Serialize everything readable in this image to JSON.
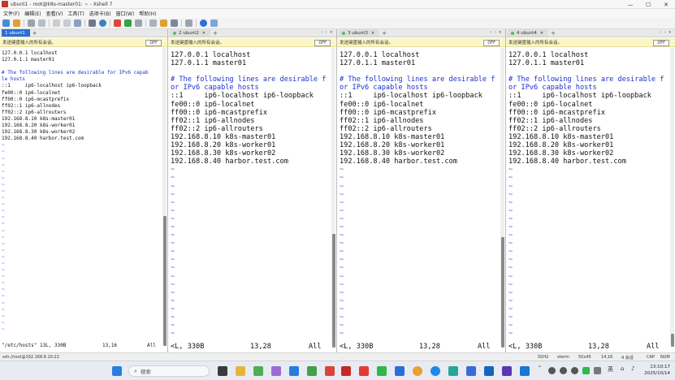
{
  "window": {
    "title": "ubunt1 - root@k8s-master01: ~ - Xshell 7",
    "controls": [
      "—",
      "☐",
      "✕"
    ]
  },
  "menu": [
    "文件(F)",
    "编辑(E)",
    "查看(V)",
    "工具(T)",
    "选项卡(B)",
    "窗口(W)",
    "帮助(H)"
  ],
  "send_bar": {
    "text": "发送键盘输入的所有会话。",
    "button": "OFF"
  },
  "panes": [
    {
      "tab_label": "1 ubunt1",
      "lines": [
        "127.0.0.1 localhost",
        "127.0.1.1 master01",
        "",
        "# The following lines are desirable for IPv6 capab",
        "le hosts",
        "::1     ip6-localhost ip6-loopback",
        "fe00::0 ip6-localnet",
        "ff00::0 ip6-mcastprefix",
        "ff02::1 ip6-allnodes",
        "ff02::2 ip6-allrouters",
        "192.168.8.10 k8s-master01",
        "192.168.8.20 k8s-worker01",
        "192.168.8.30 k8s-worker02",
        "192.168.8.40 harbor.test.com"
      ],
      "tilde_count": 29,
      "status_left": "\"/etc/hosts\" 13L, 330B",
      "status_pos": "13,16",
      "status_right": "All"
    },
    {
      "tab_label": "2 ubunt2",
      "lines": [
        "127.0.0.1 localhost",
        "127.0.1.1 master01",
        "",
        "# The following lines are desirable f",
        "or IPv6 capable hosts",
        "::1     ip6-localhost ip6-loopback",
        "fe00::0 ip6-localnet",
        "ff00::0 ip6-mcastprefix",
        "ff02::1 ip6-allnodes",
        "ff02::2 ip6-allrouters",
        "192.168.8.10 k8s-master01",
        "192.168.8.20 k8s-worker01",
        "192.168.8.30 k8s-worker02",
        "192.168.8.40 harbor.test.com"
      ],
      "tilde_count": 21,
      "status_left": "<L, 330B",
      "status_pos": "13,28",
      "status_right": "All"
    },
    {
      "tab_label": "3 ubunt3",
      "lines": [
        "127.0.0.1 localhost",
        "127.0.1.1 master01",
        "",
        "# The following lines are desirable f",
        "or IPv6 capable hosts",
        "::1     ip6-localhost ip6-loopback",
        "fe00::0 ip6-localnet",
        "ff00::0 ip6-mcastprefix",
        "ff02::1 ip6-allnodes",
        "ff02::2 ip6-allrouters",
        "192.168.8.10 k8s-master01",
        "192.168.8.20 k8s-worker01",
        "192.168.8.30 k8s-worker02",
        "192.168.8.40 harbor.test.com"
      ],
      "tilde_count": 21,
      "status_left": "<L, 330B",
      "status_pos": "13,28",
      "status_right": "All"
    },
    {
      "tab_label": "4 ubunt4",
      "lines": [
        "127.0.0.1 localhost",
        "127.0.1.1 master01",
        "",
        "# The following lines are desirable f",
        "or IPv6 capable hosts",
        "::1     ip6-localhost ip6-loopback",
        "fe00::0 ip6-localnet",
        "ff00::0 ip6-mcastprefix",
        "ff02::1 ip6-allnodes",
        "ff02::2 ip6-allrouters",
        "192.168.8.10 k8s-master01",
        "192.168.8.20 k8s-worker01",
        "192.168.8.30 k8s-worker02",
        "192.168.8.40 harbor.test.com"
      ],
      "tilde_count": 21,
      "status_left": "<L, 330B",
      "status_pos": "13,28",
      "status_right": "All"
    }
  ],
  "xshell_status": {
    "connection": "ssh://root@192.168.8.10:22",
    "protocol": "SSH2",
    "term": "xterm",
    "size": "50x45",
    "cursor": "14,16",
    "sessions": "4 会话",
    "caps": "CAP",
    "num": "NUM"
  },
  "taskbar": {
    "search_placeholder": "搜索",
    "ime": "英",
    "time": "13:10:17",
    "date": "2025/10/14"
  },
  "colors": {
    "active_tab": "#2a6fd6",
    "comment": "#1d2fd0",
    "tilde": "#3a5fd9",
    "send_bar": "#fbf6c8"
  }
}
